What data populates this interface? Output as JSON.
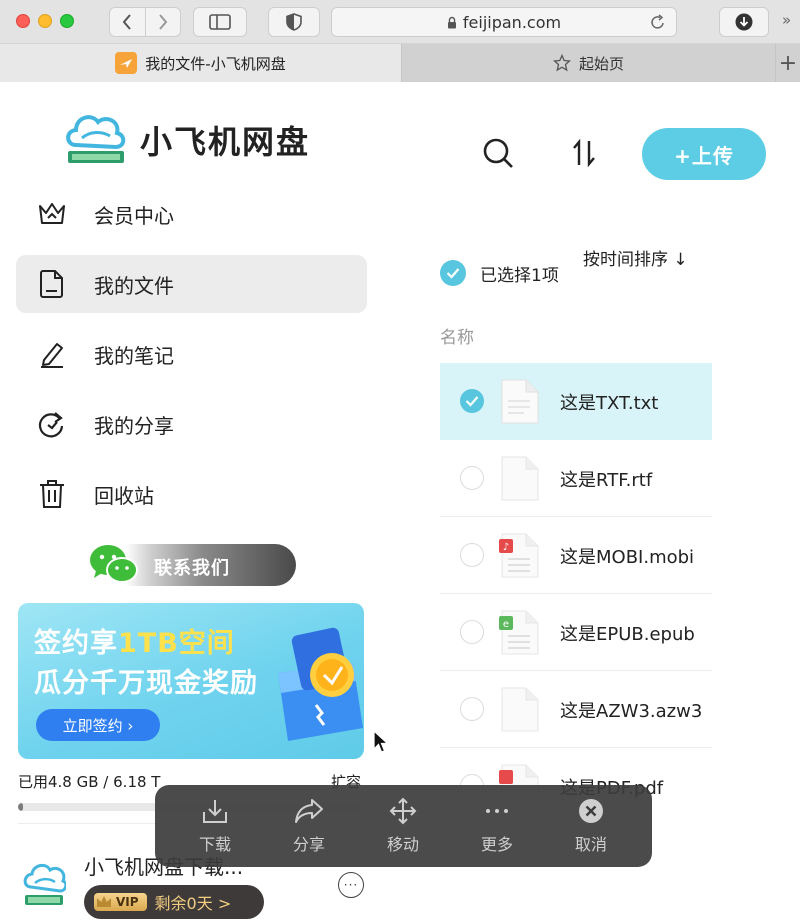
{
  "browser": {
    "url": "feijipan.com",
    "tabs": [
      {
        "label": "我的文件-小飞机网盘",
        "active": true
      },
      {
        "label": "起始页",
        "active": false
      }
    ]
  },
  "brand": {
    "name": "小飞机网盘"
  },
  "sidebar": {
    "items": [
      {
        "label": "会员中心",
        "icon": "crown-icon"
      },
      {
        "label": "我的文件",
        "icon": "document-icon",
        "active": true
      },
      {
        "label": "我的笔记",
        "icon": "pen-icon"
      },
      {
        "label": "我的分享",
        "icon": "share-icon"
      },
      {
        "label": "回收站",
        "icon": "trash-icon"
      }
    ],
    "contact_label": "联系我们",
    "banner": {
      "line1_prefix": "签约享",
      "line1_highlight": "1TB空间",
      "line2": "瓜分千万现金奖励",
      "button": "立即签约 ›"
    },
    "storage": {
      "text": "已用4.8 GB / 6.18 T",
      "expand": "扩容",
      "used_fraction": 0.0008
    },
    "user": {
      "name": "小飞机网盘下载...",
      "vip": "VIP",
      "vip_text": "剩余0天 >"
    }
  },
  "toolbar": {
    "upload_label": "+上传"
  },
  "files": {
    "selected_text": "已选择1项",
    "sort_label": "按时间排序 ↓",
    "column_name": "名称",
    "rows": [
      {
        "name": "这是TXT.txt",
        "type": "txt",
        "selected": true
      },
      {
        "name": "这是RTF.rtf",
        "type": "rtf",
        "selected": false
      },
      {
        "name": "这是MOBI.mobi",
        "type": "mobi",
        "selected": false
      },
      {
        "name": "这是EPUB.epub",
        "type": "epub",
        "selected": false
      },
      {
        "name": "这是AZW3.azw3",
        "type": "azw3",
        "selected": false
      },
      {
        "name": "这是PDF.pdf",
        "type": "pdf",
        "selected": false
      }
    ]
  },
  "actions": [
    {
      "label": "下载",
      "icon": "download-icon"
    },
    {
      "label": "分享",
      "icon": "share-arrow-icon"
    },
    {
      "label": "移动",
      "icon": "move-icon"
    },
    {
      "label": "更多",
      "icon": "more-icon"
    },
    {
      "label": "取消",
      "icon": "cancel-icon"
    }
  ],
  "colors": {
    "accent": "#5ccde4",
    "selected_row": "#d9f4f8",
    "action_bar": "#3c3c3c"
  }
}
